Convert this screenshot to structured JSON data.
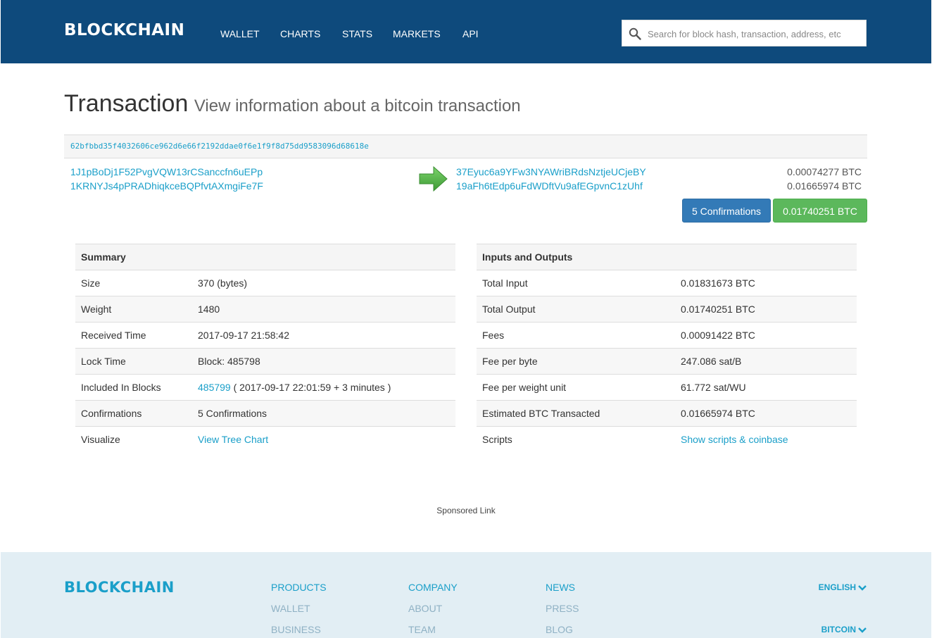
{
  "header": {
    "logo": "BLOCKCHAIN",
    "nav": [
      "WALLET",
      "CHARTS",
      "STATS",
      "MARKETS",
      "API"
    ],
    "search_placeholder": "Search for block hash, transaction, address, etc"
  },
  "page": {
    "title": "Transaction",
    "subtitle": "View information about a bitcoin transaction"
  },
  "tx": {
    "hash": "62bfbbd35f4032606ce962d6e66f2192ddae0f6e1f9f8d75dd9583096d68618e",
    "inputs": [
      "1J1pBoDj1F52PvgVQW13rCSanccfn6uEPp",
      "1KRNYJs4pPRADhiqkceBQPfvtAXmgiFe7F"
    ],
    "outputs": [
      {
        "address": "37Eyuc6a9YFw3NYAWriBRdsNztjeUCjeBY",
        "amount": "0.00074277 BTC"
      },
      {
        "address": "19aFh6tEdp6uFdWDftVu9afEGpvnC1zUhf",
        "amount": "0.01665974 BTC"
      }
    ],
    "confirmations_button": "5 Confirmations",
    "total_button": "0.01740251 BTC"
  },
  "summary": {
    "heading": "Summary",
    "size": {
      "label": "Size",
      "value": "370 (bytes)"
    },
    "weight": {
      "label": "Weight",
      "value": "1480"
    },
    "received": {
      "label": "Received Time",
      "value": "2017-09-17 21:58:42"
    },
    "lock": {
      "label": "Lock Time",
      "value": "Block: 485798"
    },
    "included": {
      "label": "Included In Blocks",
      "block": "485799",
      "detail": " ( 2017-09-17 22:01:59 + 3 minutes )"
    },
    "confirmations": {
      "label": "Confirmations",
      "value": "5 Confirmations"
    },
    "visualize": {
      "label": "Visualize",
      "value": "View Tree Chart"
    }
  },
  "io": {
    "heading": "Inputs and Outputs",
    "total_input": {
      "label": "Total Input",
      "value": "0.01831673 BTC"
    },
    "total_output": {
      "label": "Total Output",
      "value": "0.01740251 BTC"
    },
    "fees": {
      "label": "Fees",
      "value": "0.00091422 BTC"
    },
    "fee_byte": {
      "label": "Fee per byte",
      "value": "247.086 sat/B"
    },
    "fee_wu": {
      "label": "Fee per weight unit",
      "value": "61.772 sat/WU"
    },
    "estimated": {
      "label": "Estimated BTC Transacted",
      "value": "0.01665974 BTC"
    },
    "scripts": {
      "label": "Scripts",
      "value": "Show scripts & coinbase"
    }
  },
  "sponsored": "Sponsored Link",
  "footer": {
    "logo": "BLOCKCHAIN",
    "products": {
      "heading": "PRODUCTS",
      "items": [
        "WALLET",
        "BUSINESS"
      ]
    },
    "company": {
      "heading": "COMPANY",
      "items": [
        "ABOUT",
        "TEAM"
      ]
    },
    "news": {
      "heading": "NEWS",
      "items": [
        "PRESS",
        "BLOG"
      ]
    },
    "language": "ENGLISH",
    "currency": "BITCOIN"
  },
  "colors": {
    "header_bg": "#0e4a7c",
    "link": "#1a9fc9",
    "confirm_btn": "#337ab7",
    "total_btn": "#5cb85c",
    "footer_bg": "#e2eef4"
  },
  "icons": {
    "search": "search-icon",
    "arrow": "arrow-right-icon",
    "chevron": "chevron-down-icon"
  }
}
